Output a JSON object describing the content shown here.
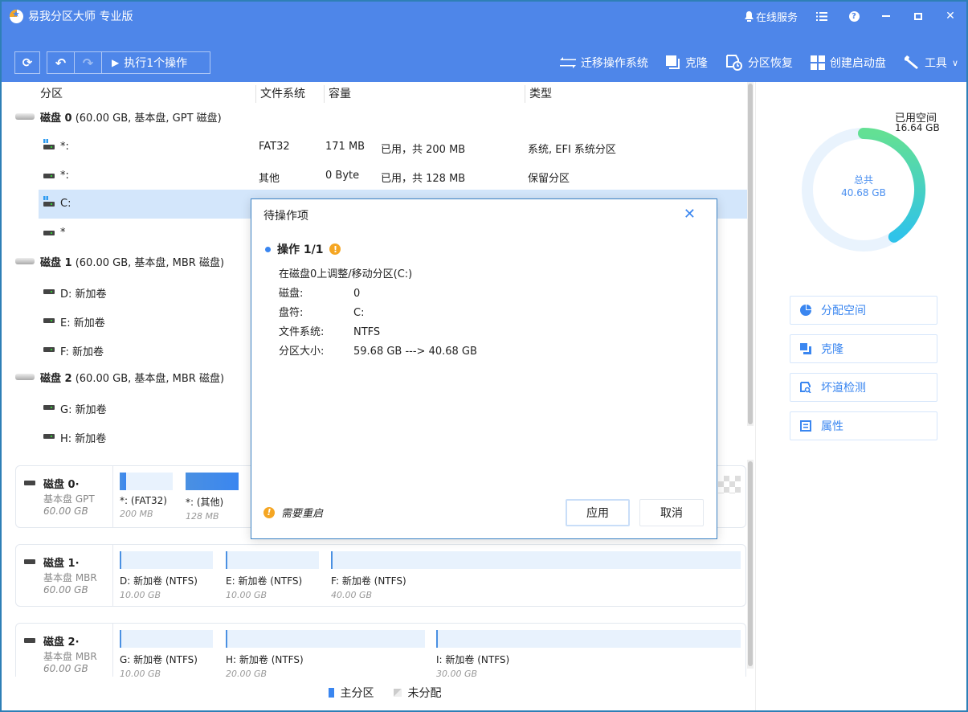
{
  "app": {
    "title": "易我分区大师 专业版",
    "online_service": "在线服务",
    "icons": {
      "menu": "list-icon",
      "help": "help-icon",
      "minimize": "minimize-icon",
      "maximize": "maximize-icon",
      "close": "close-icon"
    }
  },
  "toolbar": {
    "refresh_icon": "⟳",
    "undo_icon": "↶",
    "redo_icon": "↷",
    "execute_label": "执行1个操作",
    "right_items": [
      {
        "label": "迁移操作系统",
        "icon": "migrate-icon"
      },
      {
        "label": "克隆",
        "icon": "clone-icon"
      },
      {
        "label": "分区恢复",
        "icon": "partition-recovery-icon"
      },
      {
        "label": "创建启动盘",
        "icon": "bootable-media-icon"
      },
      {
        "label": "工具",
        "icon": "wrench-icon"
      }
    ]
  },
  "list": {
    "headers": {
      "partition": "分区",
      "filesystem": "文件系统",
      "capacity": "容量",
      "type": "类型"
    },
    "disks": [
      {
        "name": "磁盘 0",
        "detail": " (60.00 GB, 基本盘, GPT 磁盘)"
      },
      {
        "name": "磁盘 1",
        "detail": " (60.00 GB, 基本盘, MBR 磁盘)"
      },
      {
        "name": "磁盘 2",
        "detail": " (60.00 GB, 基本盘, MBR 磁盘)"
      }
    ],
    "partitions": [
      {
        "name": "*:",
        "fs": "FAT32",
        "used": "171 MB",
        "total": "已用，共  200 MB",
        "type": "系统, EFI 系统分区"
      },
      {
        "name": "*:",
        "fs": "其他",
        "used": "0 Byte",
        "total": "已用，共  128 MB",
        "type": "保留分区"
      },
      {
        "name": "C:",
        "fs": "",
        "used": "",
        "total": "",
        "type": ""
      },
      {
        "name": "*",
        "fs": "",
        "used": "",
        "total": "",
        "type": ""
      },
      {
        "name": "D: 新加卷"
      },
      {
        "name": "E: 新加卷"
      },
      {
        "name": "F: 新加卷"
      },
      {
        "name": "G: 新加卷"
      },
      {
        "name": "H: 新加卷"
      }
    ]
  },
  "disk_map": [
    {
      "name": "磁盘 0·",
      "type": "基本盘 GPT",
      "size": "60.00 GB",
      "segments": [
        {
          "label": "*:  (FAT32)",
          "size": "200 MB",
          "used_fraction": 0.05
        },
        {
          "label": "*:  (其他)",
          "size": "128 MB",
          "used_fraction": 1.0
        }
      ]
    },
    {
      "name": "磁盘 1·",
      "type": "基本盘 MBR",
      "size": "60.00 GB",
      "segments": [
        {
          "label": "D: 新加卷 (NTFS)",
          "size": "10.00 GB",
          "used_fraction": 0
        },
        {
          "label": "E: 新加卷 (NTFS)",
          "size": "10.00 GB",
          "used_fraction": 0
        },
        {
          "label": "F: 新加卷 (NTFS)",
          "size": "40.00 GB",
          "used_fraction": 0
        }
      ]
    },
    {
      "name": "磁盘 2·",
      "type": "基本盘 MBR",
      "size": "60.00 GB",
      "segments": [
        {
          "label": "G: 新加卷 (NTFS)",
          "size": "10.00 GB",
          "used_fraction": 0
        },
        {
          "label": "H: 新加卷 (NTFS)",
          "size": "20.00 GB",
          "used_fraction": 0
        },
        {
          "label": "I: 新加卷 (NTFS)",
          "size": "30.00 GB",
          "used_fraction": 0
        }
      ]
    }
  ],
  "legend": {
    "primary": "主分区",
    "unallocated": "未分配"
  },
  "right_panel": {
    "used_label": "已用空间",
    "used_value": "16.64 GB",
    "total_label": "总共",
    "total_value": "40.68 GB",
    "used_fraction": 0.409,
    "buttons": [
      {
        "label": "分配空间",
        "icon": "allocate-space-icon"
      },
      {
        "label": "克隆",
        "icon": "clone-icon"
      },
      {
        "label": "坏道检测",
        "icon": "surface-test-icon"
      },
      {
        "label": "属性",
        "icon": "properties-icon"
      }
    ]
  },
  "colors": {
    "brand": "#4e86e9",
    "accent": "#3a86f0",
    "warning": "#f5a623",
    "selected_row": "#d3e6fb"
  },
  "dialog": {
    "title": "待操作项",
    "op_title": "操作 1/1",
    "op_desc": "在磁盘0上调整/移动分区(C:)",
    "fields": [
      {
        "key": "磁盘:",
        "value": "0"
      },
      {
        "key": "盘符:",
        "value": "C:"
      },
      {
        "key": "文件系统:",
        "value": "NTFS"
      },
      {
        "key": "分区大小:",
        "value": "59.68 GB ---> 40.68 GB"
      }
    ],
    "reboot_note": "需要重启",
    "apply_label": "应用",
    "cancel_label": "取消"
  }
}
